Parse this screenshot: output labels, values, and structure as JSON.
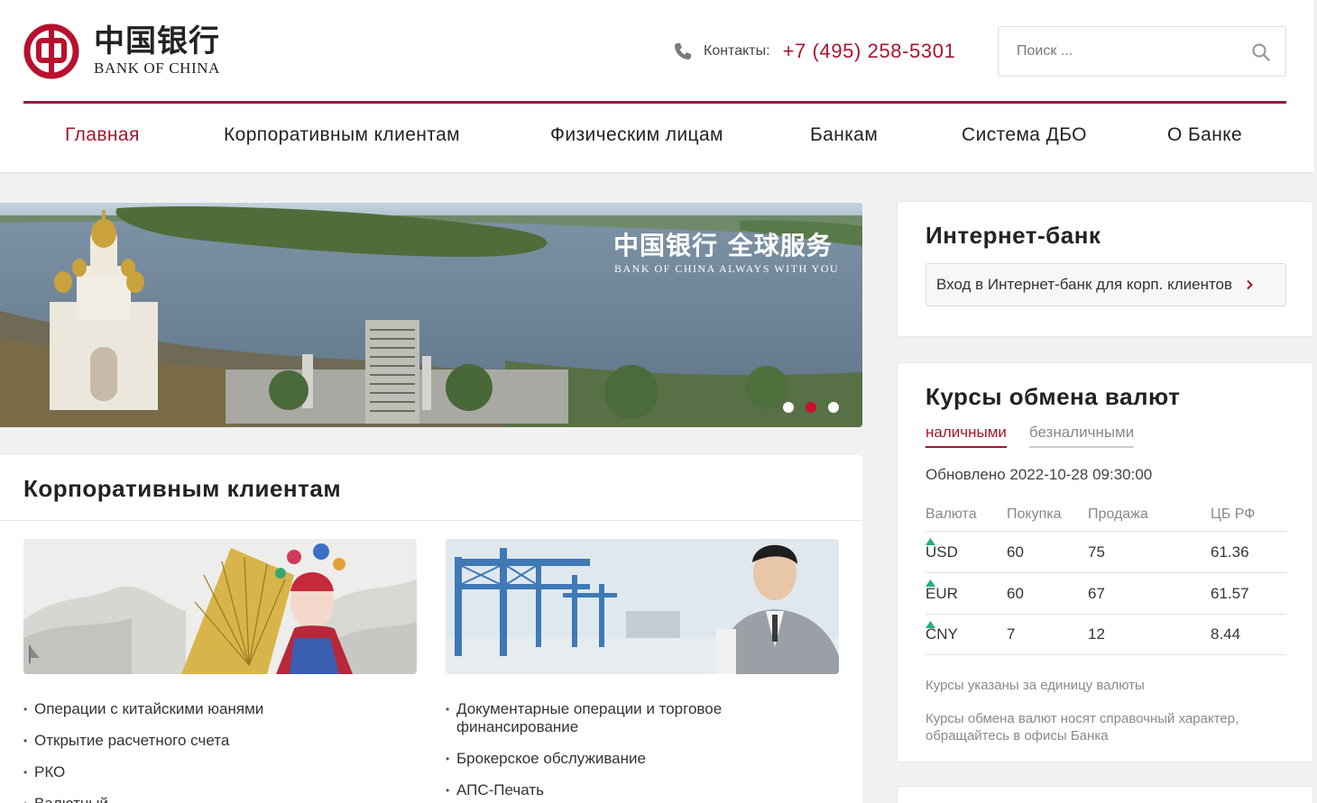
{
  "header": {
    "logo_cn": "中国银行",
    "logo_en": "BANK OF CHINA",
    "contacts_label": "Контакты:",
    "contacts_phone": "+7 (495) 258-5301",
    "search_placeholder": "Поиск ..."
  },
  "nav": {
    "items": [
      {
        "label": "Главная",
        "active": true
      },
      {
        "label": "Корпоративным клиентам"
      },
      {
        "label": "Физическим лицам"
      },
      {
        "label": "Банкам"
      },
      {
        "label": "Система ДБО"
      },
      {
        "label": "О Банке"
      }
    ]
  },
  "banner": {
    "slogan_cn": "中国银行 全球服务",
    "slogan_en": "BANK OF CHINA   ALWAYS WITH YOU",
    "slides_total": 3,
    "active_slide": 2
  },
  "corporate": {
    "title": "Корпоративным клиентам",
    "left_list": [
      "Операции с китайскими юанями",
      "Открытие расчетного счета",
      "РКО",
      "Валютный..."
    ],
    "right_list": [
      "Документарные операции и торговое финансирование",
      "Брокерское обслуживание",
      "АПС-Печать"
    ]
  },
  "internet_bank": {
    "title": "Интернет-банк",
    "button_label": "Вход в Интернет-банк для корп. клиентов"
  },
  "fx": {
    "title": "Курсы обмена валют",
    "tabs": [
      {
        "label": "наличными",
        "active": true
      },
      {
        "label": "безналичными"
      }
    ],
    "updated": "Обновлено 2022-10-28 09:30:00",
    "columns": [
      "Валюта",
      "Покупка",
      "Продажа",
      "ЦБ РФ"
    ],
    "rows": [
      {
        "currency": "USD",
        "buy": "60",
        "sell": "75",
        "trend": "up",
        "cbr": "61.36"
      },
      {
        "currency": "EUR",
        "buy": "60",
        "sell": "67",
        "trend": "up",
        "cbr": "61.57"
      },
      {
        "currency": "CNY",
        "buy": "7",
        "sell": "12",
        "trend": "up",
        "cbr": "8.44"
      }
    ],
    "note_unit": "Курсы указаны за единицу валюты",
    "note_disclaimer": "Курсы обмена валют носят справочный характер, обращайтесь в офисы Банка"
  },
  "colors": {
    "brand": "#a8152f",
    "rule": "#8f1d3a",
    "trend_up": "#21b07a"
  }
}
